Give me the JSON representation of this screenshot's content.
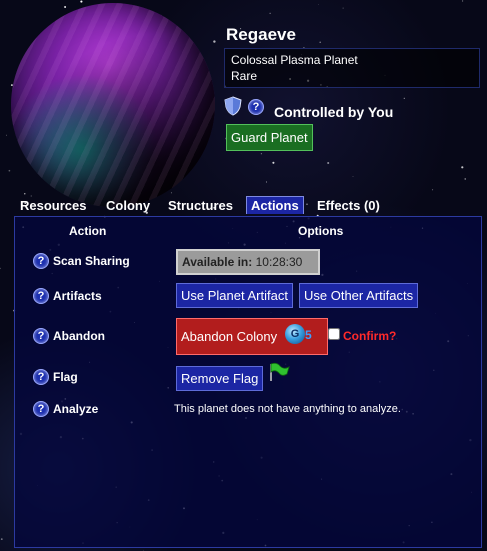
{
  "planet": {
    "name": "Regaeve",
    "type": "Colossal Plasma Planet",
    "rarity": "Rare",
    "control_status": "Controlled by You",
    "guard_button": "Guard Planet"
  },
  "tabs": [
    {
      "label": "Resources",
      "active": false
    },
    {
      "label": "Colony",
      "active": false
    },
    {
      "label": "Structures",
      "active": false
    },
    {
      "label": "Actions",
      "active": true
    },
    {
      "label": "Effects (0)",
      "active": false
    }
  ],
  "actions_table": {
    "header_action": "Action",
    "header_options": "Options",
    "rows": {
      "scan": {
        "label": "Scan Sharing",
        "available_prefix": "Available in:",
        "available_time": "10:28:30"
      },
      "artifacts": {
        "label": "Artifacts",
        "use_planet_artifact": "Use Planet Artifact",
        "use_other_artifacts": "Use Other Artifacts"
      },
      "abandon": {
        "label": "Abandon",
        "button": "Abandon Colony",
        "cost": "5",
        "cost_icon_letter": "G",
        "confirm_label": "Confirm?"
      },
      "flag": {
        "label": "Flag",
        "button": "Remove Flag"
      },
      "analyze": {
        "label": "Analyze",
        "message": "This planet does not have anything to analyze."
      }
    },
    "help_glyph": "?"
  },
  "colors": {
    "primary_button": "#1c26a4",
    "guard_button": "#1a6e22",
    "danger_button": "#b21d1d",
    "confirm_text": "#ff2a2a"
  },
  "icons": [
    "shield-icon",
    "help-icon",
    "flag-icon",
    "currency-icon"
  ]
}
